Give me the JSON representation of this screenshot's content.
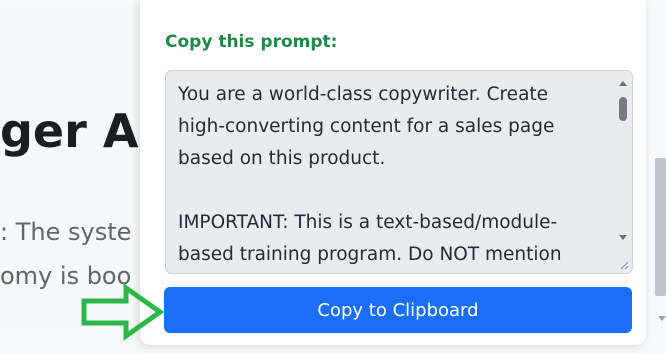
{
  "background": {
    "heading_fragment": "ger A",
    "text_line_1": ": The syste",
    "text_line_2": "omy is boo"
  },
  "panel": {
    "prompt_label": "Copy this prompt:",
    "prompt_text": "You are a world-class copywriter. Create high-converting content for a sales page based on this product.\n\nIMPORTANT: This is a text-based/module-based training program. Do NOT mention",
    "copy_button_label": "Copy to Clipboard"
  },
  "colors": {
    "label_green": "#1e8a4a",
    "button_blue": "#1a6ef7",
    "arrow_green": "#2fb64b",
    "textarea_bg": "#e9ebee"
  },
  "icons": {
    "annotation": "arrow-right-outline-icon",
    "resize": "resize-grip-icon"
  }
}
